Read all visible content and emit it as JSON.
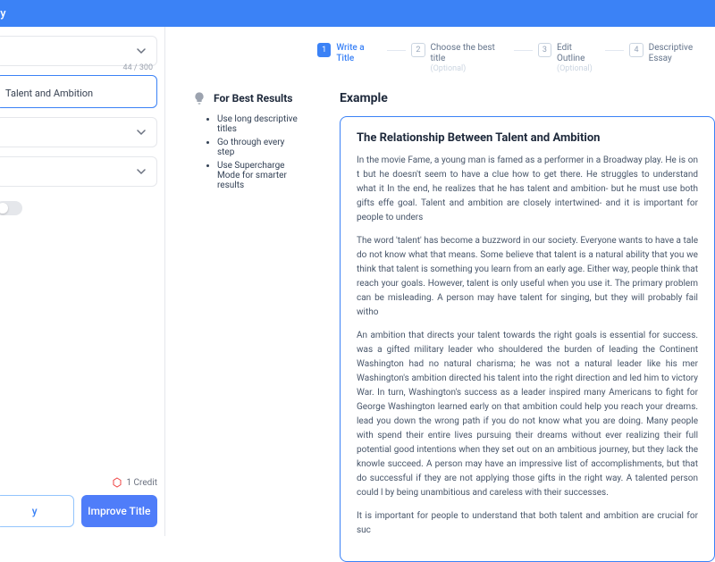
{
  "topbar": {
    "title": "ssay"
  },
  "sidebar": {
    "counter": "44 / 300",
    "input_value": "Talent and Ambition",
    "credit_label": "1 Credit",
    "btn_secondary": "y",
    "btn_primary": "Improve Title"
  },
  "steps": [
    {
      "num": "1",
      "label": "Write a Title",
      "active": true
    },
    {
      "num": "2",
      "label": "Choose the best title",
      "optional": "(Optional)"
    },
    {
      "num": "3",
      "label": "Edit Outline",
      "optional": "(Optional)"
    },
    {
      "num": "4",
      "label": "Descriptive Essay"
    }
  ],
  "tips": {
    "heading": "For Best Results",
    "items": [
      "Use long descriptive titles",
      "Go through every step",
      "Use Supercharge Mode for smarter results"
    ]
  },
  "example": {
    "label": "Example",
    "title": "The Relationship Between Talent and Ambition",
    "paragraphs": [
      "In the movie Fame, a young man is famed as a performer in a Broadway play. He is on t but he doesn't seem to have a clue how to get there. He struggles to understand what it In the end, he realizes that he has talent and ambition- but he must use both gifts effe goal. Talent and ambition are closely intertwined- and it is important for people to unders",
      "The word 'talent' has become a buzzword in our society. Everyone wants to have a tale do not know what that means. Some believe that talent is a natural ability that you we think that talent is something you learn from an early age. Either way, people think that reach your goals. However, talent is only useful when you use it. The primary problem can be misleading. A person may have talent for singing, but they will probably fail witho",
      "An ambition that directs your talent towards the right goals is essential for success. was a gifted military leader who shouldered the burden of leading the Continent Washington had no natural charisma; he was not a natural leader like his mer Washington's ambition directed his talent into the right direction and led him to victory War. In turn, Washington's success as a leader inspired many Americans to fight for George Washington learned early on that ambition could help you reach your dreams. lead you down the wrong path if you do not know what you are doing. Many people with spend their entire lives pursuing their dreams without ever realizing their full potential good intentions when they set out on an ambitious journey, but they lack the knowle succeed. A person may have an impressive list of accomplishments, but that do successful if they are not applying those gifts in the right way. A talented person could l by being unambitious and careless with their successes.",
      "It is important for people to understand that both talent and ambition are crucial for suc"
    ]
  }
}
